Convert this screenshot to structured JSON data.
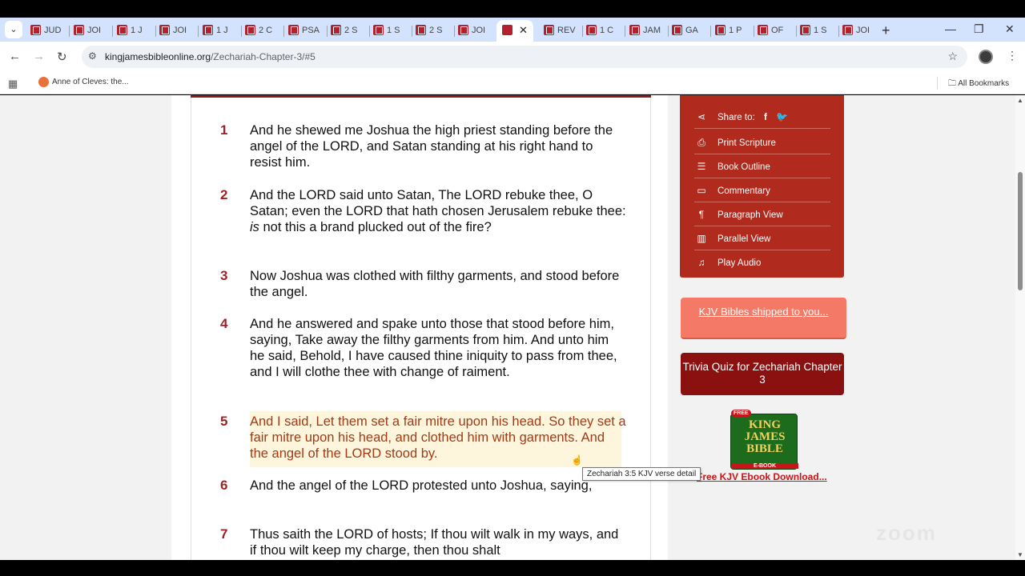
{
  "browser": {
    "tabs": [
      {
        "label": "JUD"
      },
      {
        "label": "JOI"
      },
      {
        "label": "1 J"
      },
      {
        "label": "JOI"
      },
      {
        "label": "1 J"
      },
      {
        "label": "2 C"
      },
      {
        "label": "PSA"
      },
      {
        "label": "2 S"
      },
      {
        "label": "1 S"
      },
      {
        "label": "2 S"
      },
      {
        "label": "JOI"
      },
      {
        "label": "REV"
      },
      {
        "label": "1 C"
      },
      {
        "label": "JAM"
      },
      {
        "label": "GA"
      },
      {
        "label": "1 P"
      },
      {
        "label": "OF"
      },
      {
        "label": "1 S"
      },
      {
        "label": "JOI"
      }
    ],
    "active_tab_close": "✕",
    "url_domain": "kingjamesbibleonline.org",
    "url_path": "/Zechariah-Chapter-3/#5",
    "bookmark_item": "Anne of Cleves: the...",
    "all_bookmarks": "All Bookmarks"
  },
  "verses": [
    {
      "num": "1",
      "text": "And he shewed me Joshua the high priest standing before the angel of the LORD, and Satan standing at his right hand to resist him."
    },
    {
      "num": "2",
      "text_before": "And the LORD said unto Satan, The LORD rebuke thee, O Satan; even the LORD that hath chosen Jerusalem rebuke thee: ",
      "text_italic": "is",
      "text_after": " not this a brand plucked out of the fire?"
    },
    {
      "num": "3",
      "text": "Now Joshua was clothed with filthy garments, and stood before the angel."
    },
    {
      "num": "4",
      "text": "And he answered and spake unto those that stood before him, saying, Take away the filthy garments from him. And unto him he said, Behold, I have caused thine iniquity to pass from thee, and I will clothe thee with change of raiment."
    },
    {
      "num": "5",
      "text": "And I said, Let them set a fair mitre upon his head. So they set a fair mitre upon his head, and clothed him with garments. And the angel of the LORD stood by."
    },
    {
      "num": "6",
      "text": "And the angel of the LORD protested unto Joshua, saying,"
    },
    {
      "num": "7",
      "text": "Thus saith the LORD of hosts; If thou wilt walk in my ways, and if thou wilt keep my charge, then thou shalt"
    }
  ],
  "tooltip": "Zechariah 3:5 KJV verse detail",
  "sidebar": {
    "share_label": "Share to:",
    "facebook": "f",
    "items": [
      {
        "label": "Print Scripture",
        "icon": "printer-icon"
      },
      {
        "label": "Book Outline",
        "icon": "list-icon"
      },
      {
        "label": "Commentary",
        "icon": "book-icon"
      },
      {
        "label": "Paragraph View",
        "icon": "pilcrow-icon"
      },
      {
        "label": "Parallel View",
        "icon": "columns-icon"
      },
      {
        "label": "Play Audio",
        "icon": "headphones-icon"
      }
    ]
  },
  "kjv_ship": "KJV Bibles shipped to you...",
  "trivia": "Trivia Quiz for Zechariah Chapter 3",
  "ebook": {
    "free": "FREE",
    "title_line1": "KING",
    "title_line2": "JAMES",
    "title_line3": "BIBLE",
    "badge": "E-BOOK",
    "link": "Free KJV Ebook Download..."
  },
  "colors": {
    "verse_number": "#9b2226",
    "highlight_text": "#a33a16",
    "sidebar_bg": "#b02a1e",
    "ship_button": "#f47a67",
    "trivia_button": "#8b1111"
  }
}
